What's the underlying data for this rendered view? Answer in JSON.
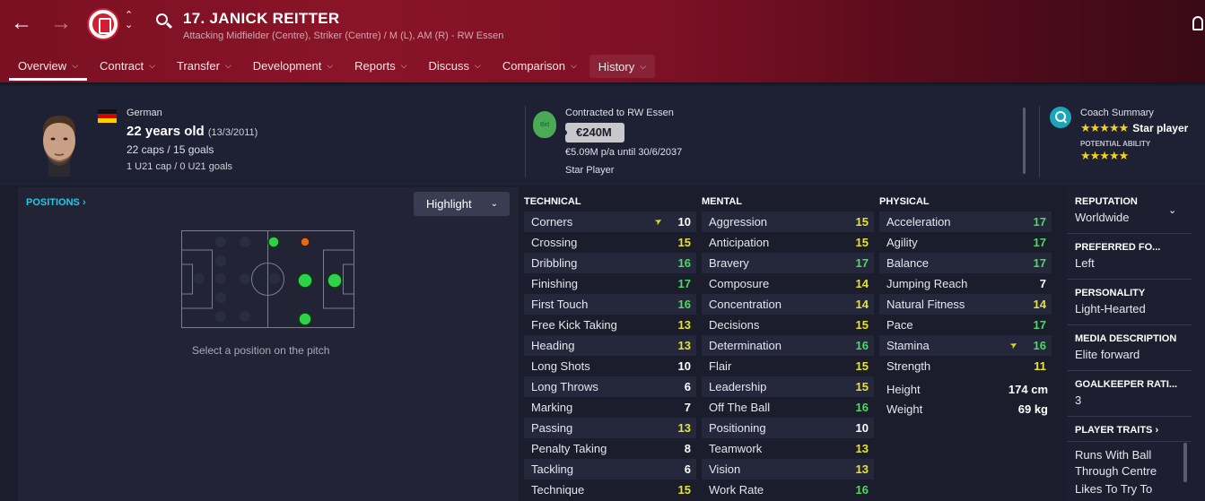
{
  "header": {
    "title": "17. JANICK REITTER",
    "subtitle": "Attacking Midfielder (Centre), Striker (Centre) / M (L), AM (R) - RW Essen",
    "colors": {
      "bg": "#7a1022",
      "club_red": "#d21e30"
    }
  },
  "tabs": [
    {
      "label": "Overview",
      "active": true
    },
    {
      "label": "Contract"
    },
    {
      "label": "Transfer"
    },
    {
      "label": "Development"
    },
    {
      "label": "Reports"
    },
    {
      "label": "Discuss"
    },
    {
      "label": "Comparison"
    },
    {
      "label": "History"
    }
  ],
  "info": {
    "nationality": "German",
    "age": "22 years old",
    "dob": "(13/3/2011)",
    "caps": "22 caps / 15 goals",
    "u21": "1 U21 cap / 0 U21 goals"
  },
  "contract": {
    "bid_label": "Bid",
    "label": "Contracted to RW Essen",
    "value": "€240M",
    "wage": "€5.09M p/a until 30/6/2037",
    "status": "Star Player"
  },
  "coach": {
    "label": "Coach Summary",
    "ability_stars": "★★★★★",
    "ability_text": "Star player",
    "potential_label": "POTENTIAL ABILITY",
    "potential_stars": "★★★★★"
  },
  "positions": {
    "title": "POSITIONS",
    "highlight_label": "Highlight",
    "hint": "Select a position on the pitch"
  },
  "attributes": {
    "technical_title": "TECHNICAL",
    "mental_title": "MENTAL",
    "physical_title": "PHYSICAL",
    "technical": [
      {
        "name": "Corners",
        "value": "10",
        "arrow": true
      },
      {
        "name": "Crossing",
        "value": "15"
      },
      {
        "name": "Dribbling",
        "value": "16"
      },
      {
        "name": "Finishing",
        "value": "17"
      },
      {
        "name": "First Touch",
        "value": "16"
      },
      {
        "name": "Free Kick Taking",
        "value": "13"
      },
      {
        "name": "Heading",
        "value": "13"
      },
      {
        "name": "Long Shots",
        "value": "10"
      },
      {
        "name": "Long Throws",
        "value": "6"
      },
      {
        "name": "Marking",
        "value": "7"
      },
      {
        "name": "Passing",
        "value": "13"
      },
      {
        "name": "Penalty Taking",
        "value": "8"
      },
      {
        "name": "Tackling",
        "value": "6"
      },
      {
        "name": "Technique",
        "value": "15"
      }
    ],
    "mental": [
      {
        "name": "Aggression",
        "value": "15"
      },
      {
        "name": "Anticipation",
        "value": "15"
      },
      {
        "name": "Bravery",
        "value": "17"
      },
      {
        "name": "Composure",
        "value": "14"
      },
      {
        "name": "Concentration",
        "value": "14"
      },
      {
        "name": "Decisions",
        "value": "15"
      },
      {
        "name": "Determination",
        "value": "16"
      },
      {
        "name": "Flair",
        "value": "15"
      },
      {
        "name": "Leadership",
        "value": "15"
      },
      {
        "name": "Off The Ball",
        "value": "16"
      },
      {
        "name": "Positioning",
        "value": "10"
      },
      {
        "name": "Teamwork",
        "value": "13"
      },
      {
        "name": "Vision",
        "value": "13"
      },
      {
        "name": "Work Rate",
        "value": "16"
      }
    ],
    "physical": [
      {
        "name": "Acceleration",
        "value": "17"
      },
      {
        "name": "Agility",
        "value": "17"
      },
      {
        "name": "Balance",
        "value": "17"
      },
      {
        "name": "Jumping Reach",
        "value": "7"
      },
      {
        "name": "Natural Fitness",
        "value": "14"
      },
      {
        "name": "Pace",
        "value": "17"
      },
      {
        "name": "Stamina",
        "value": "16",
        "arrow": true
      },
      {
        "name": "Strength",
        "value": "11"
      }
    ],
    "height_label": "Height",
    "height": "174 cm",
    "weight_label": "Weight",
    "weight": "69 kg",
    "colors": {
      "high": "#4cd964",
      "good": "#e6e430",
      "mid": "#ffffff",
      "low": "#ffffff"
    }
  },
  "sidebar": {
    "reputation_label": "REPUTATION",
    "reputation": "Worldwide",
    "foot_label": "PREFERRED FO...",
    "foot": "Left",
    "personality_label": "PERSONALITY",
    "personality": "Light-Hearted",
    "media_label": "MEDIA DESCRIPTION",
    "media": "Elite forward",
    "gk_label": "GOALKEEPER RATI...",
    "gk": "3",
    "traits_label": "PLAYER TRAITS",
    "traits": [
      "Runs With Ball Through Centre",
      "Likes To Try To"
    ]
  }
}
